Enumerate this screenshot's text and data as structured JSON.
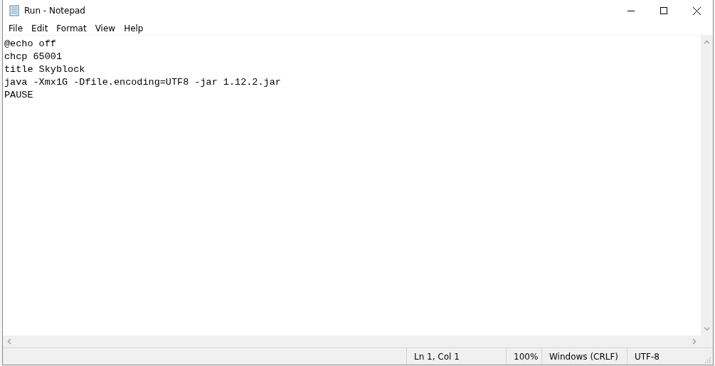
{
  "window": {
    "title": "Run - Notepad"
  },
  "menu": [
    "File",
    "Edit",
    "Format",
    "View",
    "Help"
  ],
  "editor": {
    "lines": [
      "@echo off",
      "chcp 65001",
      "title Skyblock",
      "java -Xmx1G -Dfile.encoding=UTF8 -jar 1.12.2.jar",
      "PAUSE"
    ]
  },
  "status_bar": {
    "position": "Ln 1, Col 1",
    "zoom": "100%",
    "line_ending": "Windows (CRLF)",
    "encoding": "UTF-8"
  }
}
